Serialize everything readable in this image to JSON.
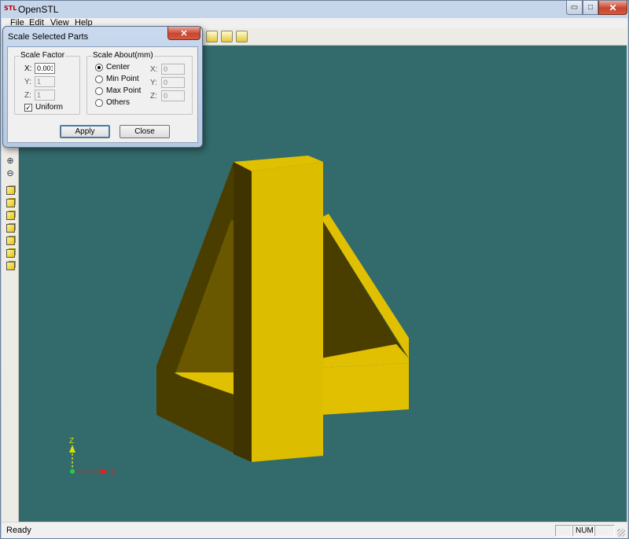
{
  "window": {
    "logo": "STL",
    "title": "OpenSTL"
  },
  "window_controls": {
    "minimize": "▭",
    "maximize": "□",
    "close": "✕"
  },
  "menu": [
    "File",
    "Edit",
    "View",
    "Help"
  ],
  "statusbar": {
    "text": "Ready",
    "panels": [
      "",
      "NUM",
      ""
    ]
  },
  "dialog": {
    "title": "Scale Selected Parts",
    "close_glyph": "✕",
    "scale_factor": {
      "label": "Scale Factor",
      "x_label": "X:",
      "x_value": "0.001",
      "y_label": "Y:",
      "y_value": "1",
      "z_label": "Z:",
      "z_value": "1",
      "uniform_label": "Uniform",
      "uniform_checked": true
    },
    "scale_about": {
      "label": "Scale About(mm)",
      "options": [
        "Center",
        "Min Point",
        "Max Point",
        "Others"
      ],
      "selected": "Center",
      "x_label": "X:",
      "x_value": "0",
      "y_label": "Y:",
      "y_value": "0",
      "z_label": "Z:",
      "z_value": "0"
    },
    "apply_label": "Apply",
    "close_label": "Close"
  },
  "axes": {
    "z_label": "Z",
    "x_label": "X"
  },
  "colors": {
    "viewport_bg": "#336a6c",
    "model_light": "#e0c000",
    "model_dark": "#4a3d00",
    "model_mid": "#6a5800"
  },
  "icons": {
    "left_toolbar": [
      "zoom-in-icon",
      "zoom-out-icon",
      "view-front-icon",
      "view-back-icon",
      "view-left-icon",
      "view-right-icon",
      "view-top-icon",
      "view-bottom-icon",
      "view-iso-icon"
    ]
  }
}
